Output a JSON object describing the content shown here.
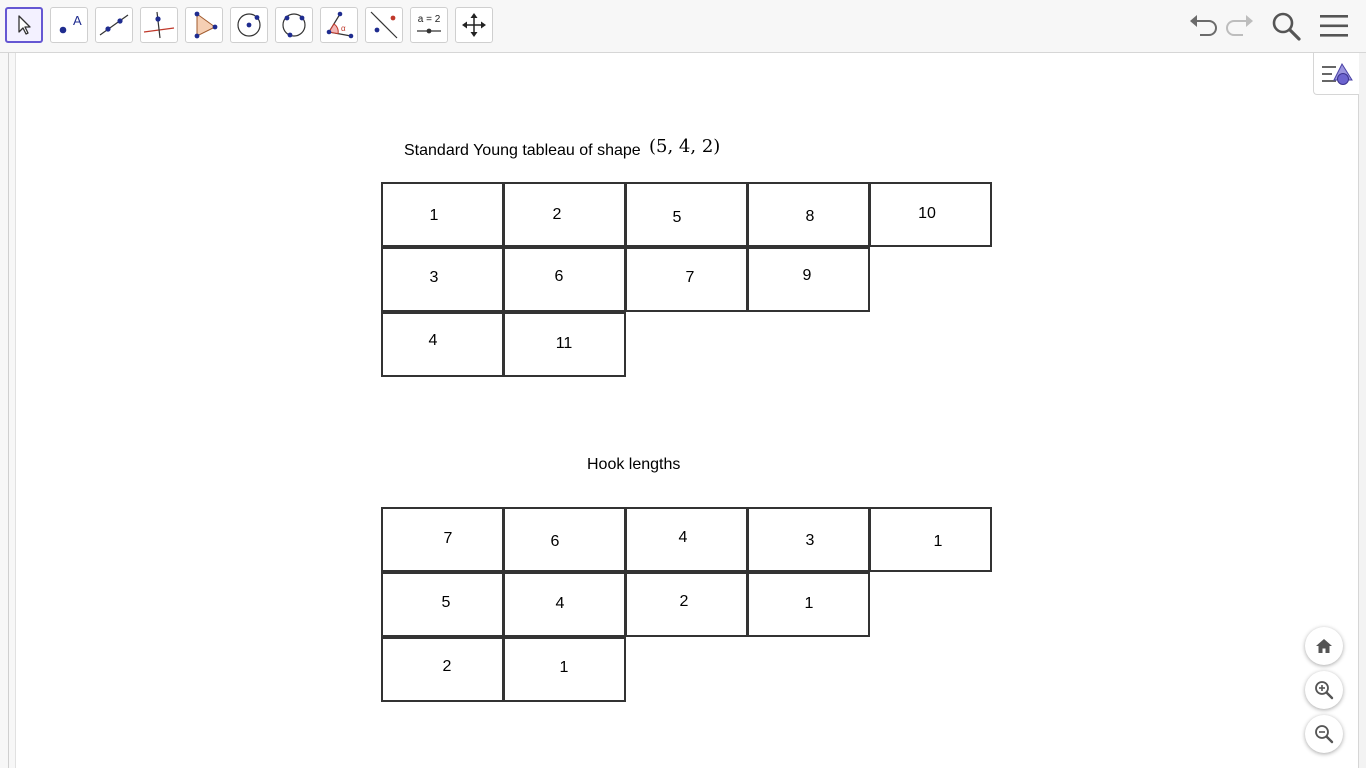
{
  "toolbar": {
    "tools": [
      {
        "name": "move-tool-button",
        "icon": "move-arrow-icon",
        "selected": true
      },
      {
        "name": "point-tool-button",
        "icon": "point-icon",
        "icon_text": "A"
      },
      {
        "name": "line-tool-button",
        "icon": "line-icon"
      },
      {
        "name": "perpendicular-line-tool-button",
        "icon": "perpendicular-line-icon"
      },
      {
        "name": "polygon-tool-button",
        "icon": "polygon-icon"
      },
      {
        "name": "circle-center-point-tool-button",
        "icon": "circle-center-icon"
      },
      {
        "name": "circle-three-points-tool-button",
        "icon": "circle-three-points-icon"
      },
      {
        "name": "angle-tool-button",
        "icon": "angle-icon",
        "icon_text": "α"
      },
      {
        "name": "reflect-tool-button",
        "icon": "reflect-about-line-icon"
      },
      {
        "name": "slider-tool-button",
        "icon": "slider-icon",
        "icon_text": "a = 2"
      },
      {
        "name": "move-graphics-view-tool-button",
        "icon": "move-graphics-view-icon"
      }
    ],
    "right": [
      "undo-icon",
      "redo-icon",
      "search-icon",
      "menu-icon"
    ]
  },
  "accent_color": "#6557d2",
  "tableau": {
    "caption": "Standard Young tableau of shape",
    "shape": "(5, 4, 2)",
    "rows": [
      [
        "1",
        "2",
        "5",
        "8",
        "10"
      ],
      [
        "3",
        "6",
        "7",
        "9"
      ],
      [
        "4",
        "11"
      ]
    ]
  },
  "hooks": {
    "caption": "Hook lengths",
    "rows": [
      [
        "7",
        "6",
        "4",
        "3",
        "1"
      ],
      [
        "5",
        "4",
        "2",
        "1"
      ],
      [
        "2",
        "1"
      ]
    ]
  },
  "view_controls": [
    "home-icon",
    "zoom-in-icon",
    "zoom-out-icon"
  ]
}
